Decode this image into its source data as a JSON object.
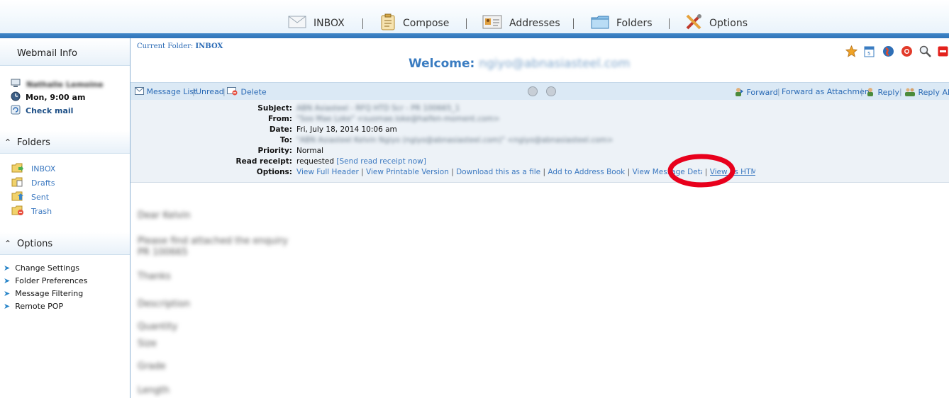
{
  "nav": {
    "inbox": "INBOX",
    "compose": "Compose",
    "addresses": "Addresses",
    "folders": "Folders",
    "options": "Options"
  },
  "sidebar": {
    "webmail_info": "Webmail Info",
    "user_name": "Nathalie Lemoine",
    "time": "Mon, 9:00 am",
    "check_mail": "Check mail",
    "folders_title": "Folders",
    "folders": [
      "INBOX",
      "Drafts",
      "Sent",
      "Trash"
    ],
    "options_title": "Options",
    "options": [
      "Change Settings",
      "Folder Preferences",
      "Message Filtering",
      "Remote POP"
    ]
  },
  "main": {
    "current_folder_label": "Current Folder:",
    "current_folder": "INBOX",
    "welcome_label": "Welcome:",
    "welcome_user": "ngiyo@abnasiasteel.com",
    "toolbar": {
      "message_list": "Message List",
      "unread": "Unread",
      "delete": "Delete",
      "forward": "Forward",
      "forward_attachment": "Forward as Attachment",
      "reply": "Reply",
      "reply_all": "Reply All"
    },
    "headers": {
      "subject_label": "Subject:",
      "subject": "ABN Asiasteel - RFQ HTD Scr - PR 100665_1",
      "from_label": "From:",
      "from": "\"Soo Mae Loke\" <suomae.loke@haifen-moment.com>",
      "date_label": "Date:",
      "date": "Fri, July 18, 2014 10:06 am",
      "to_label": "To:",
      "to": "\"ABN Asiasteel Kelvin Ngiyo (ngiyo@abnasiasteel.com)\" <ngiyo@abnasiasteel.com>",
      "priority_label": "Priority:",
      "priority": "Normal",
      "read_receipt_label": "Read receipt:",
      "read_receipt": "requested",
      "send_receipt": "[Send read receipt now]",
      "options_label": "Options:",
      "opt_full_header": "View Full Header",
      "opt_printable": "View Printable Version",
      "opt_download": "Download this as a file",
      "opt_address_book": "Add to Address Book",
      "opt_details": "View Message Details",
      "opt_html": "View as HTML"
    },
    "body_lines": [
      "Dear Kelvin",
      "Please find attached the enquiry",
      "PR 100665",
      "Thanks",
      "Description",
      "Quantity",
      "Size",
      "Grade",
      "Length"
    ]
  },
  "colors": {
    "accent": "#2f74b8",
    "link": "#3b78c0",
    "annotation": "#e8001c"
  }
}
